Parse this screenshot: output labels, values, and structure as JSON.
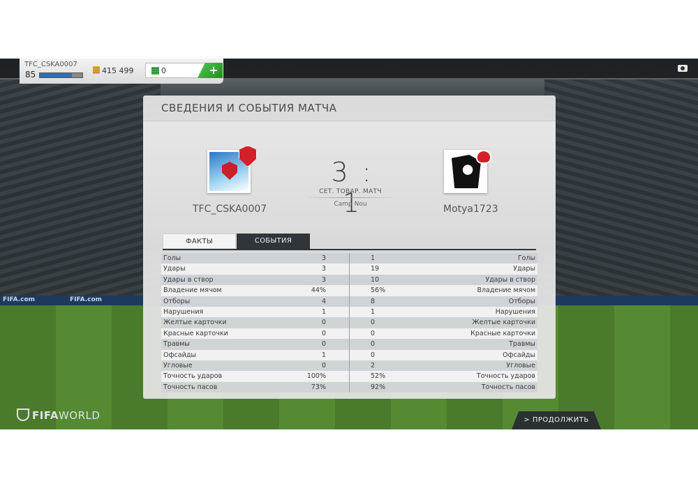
{
  "profile": {
    "name": "TFC_CSKA0007",
    "level": "85",
    "xp_progress": 0.75,
    "coins": "415 499",
    "points": "0",
    "add_label": "+"
  },
  "panel": {
    "title": "СВЕДЕНИЯ И СОБЫТИЯ МАТЧА"
  },
  "match": {
    "home_team": "TFC_CSKA0007",
    "away_team": "Motya1723",
    "score": "3 : 1",
    "type": "СЕТ. ТОВАР. МАТЧ",
    "stadium": "Camp Nou"
  },
  "tabs": {
    "facts": "ФАКТЫ",
    "events": "СОБЫТИЯ"
  },
  "stats": [
    {
      "label": "Голы",
      "home": "3",
      "away": "1"
    },
    {
      "label": "Удары",
      "home": "3",
      "away": "19"
    },
    {
      "label": "Удары в створ",
      "home": "3",
      "away": "10"
    },
    {
      "label": "Владение мячом",
      "home": "44%",
      "away": "56%"
    },
    {
      "label": "Отборы",
      "home": "4",
      "away": "8"
    },
    {
      "label": "Нарушения",
      "home": "1",
      "away": "1"
    },
    {
      "label": "Желтые карточки",
      "home": "0",
      "away": "0"
    },
    {
      "label": "Красные карточки",
      "home": "0",
      "away": "0"
    },
    {
      "label": "Травмы",
      "home": "0",
      "away": "0"
    },
    {
      "label": "Офсайды",
      "home": "1",
      "away": "0"
    },
    {
      "label": "Угловые",
      "home": "0",
      "away": "2"
    },
    {
      "label": "Точность ударов",
      "home": "100%",
      "away": "52%"
    },
    {
      "label": "Точность пасов",
      "home": "73%",
      "away": "92%"
    }
  ],
  "footer": {
    "brand_bold": "FIFA",
    "brand_thin": "WORLD",
    "continue": "> ПРОДОЛЖИТЬ"
  },
  "background": {
    "ad_text": "FIFA.com"
  },
  "colors": {
    "accent_green": "#2fa52f",
    "tab_dark": "#2f3539",
    "xp_blue": "#2e6fb5"
  }
}
